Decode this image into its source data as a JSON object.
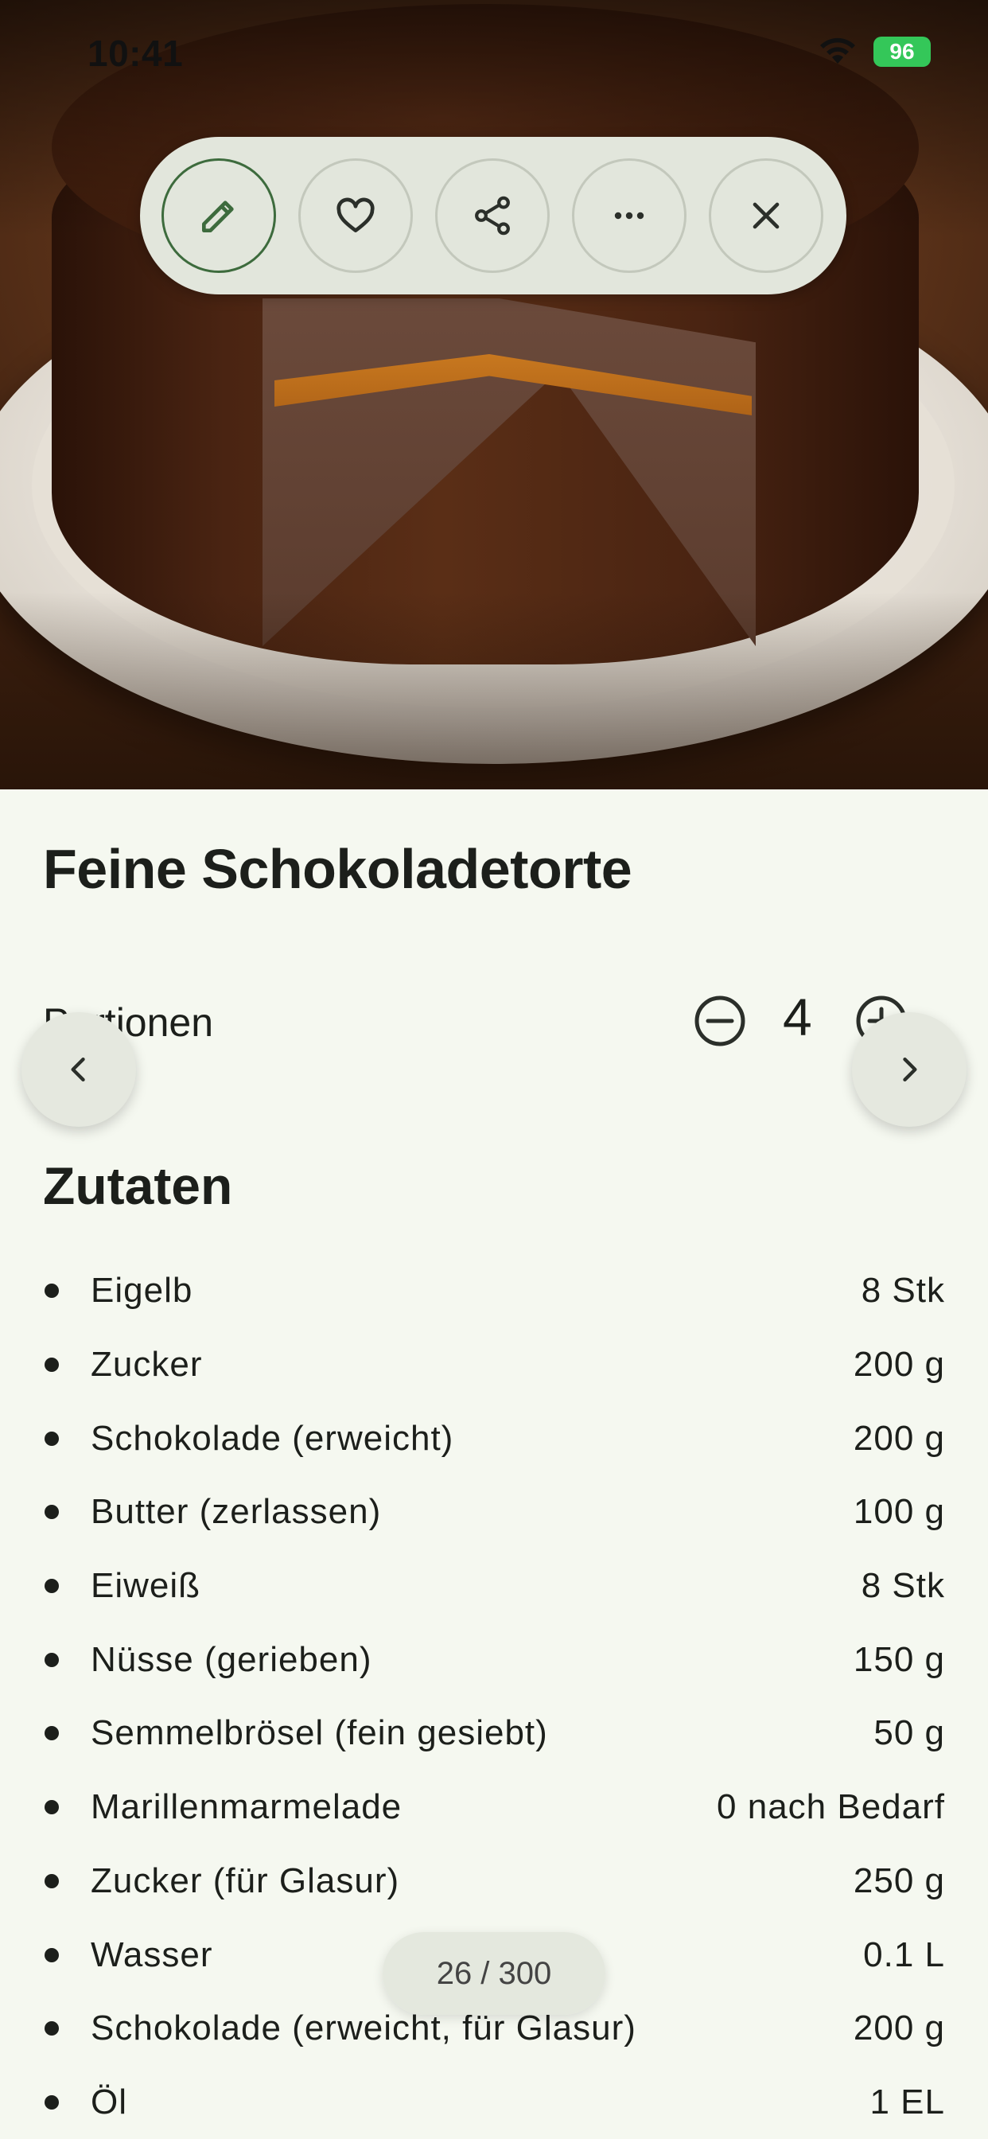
{
  "status_bar": {
    "time": "10:41",
    "battery": "96"
  },
  "actions": {
    "edit": "pencil-icon",
    "favorite": "heart-icon",
    "share": "share-icon",
    "more": "more-icon",
    "close": "close-icon"
  },
  "recipe": {
    "title": "Feine Schokoladetorte",
    "portions_label": "Portionen",
    "portions": "4",
    "ingredients_title": "Zutaten",
    "ingredients": [
      {
        "name": "Eigelb",
        "amount": "8 Stk"
      },
      {
        "name": "Zucker",
        "amount": "200 g"
      },
      {
        "name": "Schokolade (erweicht)",
        "amount": "200 g"
      },
      {
        "name": "Butter (zerlassen)",
        "amount": "100 g"
      },
      {
        "name": "Eiweiß",
        "amount": "8 Stk"
      },
      {
        "name": "Nüsse (gerieben)",
        "amount": "150 g"
      },
      {
        "name": "Semmelbrösel (fein gesiebt)",
        "amount": "50 g"
      },
      {
        "name": "Marillenmarmelade",
        "amount": "0 nach Bedarf"
      },
      {
        "name": "Zucker (für Glasur)",
        "amount": "250 g"
      },
      {
        "name": "Wasser",
        "amount": "0.1 L"
      },
      {
        "name": "Schokolade (erweicht, für Glasur)",
        "amount": "200 g"
      },
      {
        "name": "Öl",
        "amount": "1 EL"
      }
    ]
  },
  "pager": {
    "label": "26 / 300"
  },
  "colors": {
    "accent": "#3d6b3d",
    "background": "#f5f8f0",
    "battery": "#34c759"
  }
}
